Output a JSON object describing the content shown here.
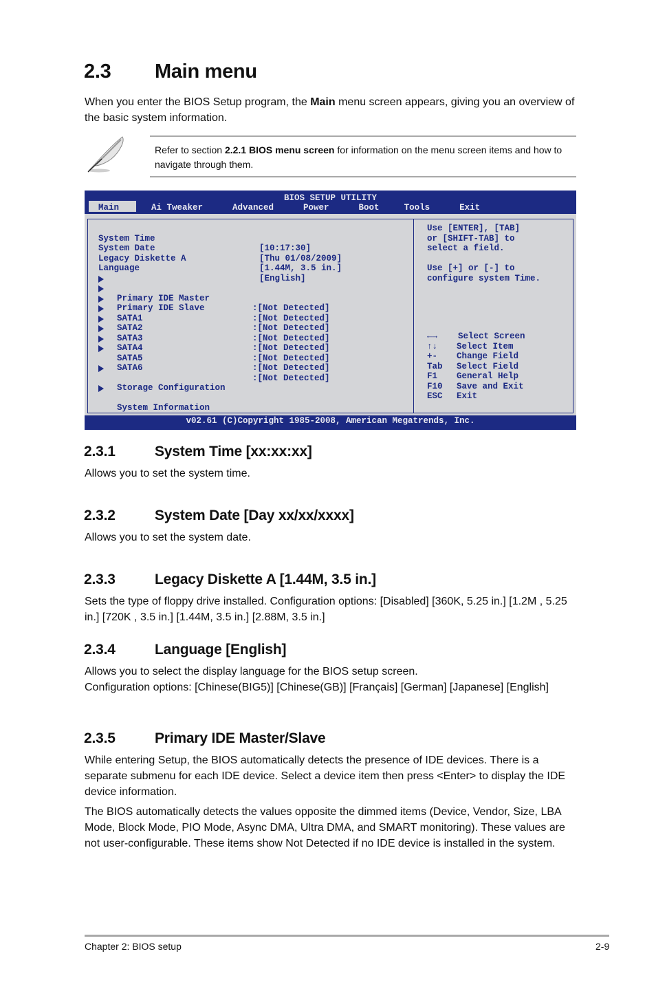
{
  "heading": {
    "number": "2.3",
    "title": "Main menu"
  },
  "intro": {
    "before": "When you enter the BIOS Setup program, the ",
    "bold": "Main",
    "after": " menu screen appears, giving you an overview of the basic system information."
  },
  "note": {
    "icon": "feather-pen-icon",
    "before": "Refer to section ",
    "bold": "2.2.1 BIOS menu screen",
    "after": " for information on the menu screen items and how to navigate through them."
  },
  "bios": {
    "title": "BIOS SETUP UTILITY",
    "tabs": [
      {
        "label": "Main",
        "active": true
      },
      {
        "label": "Ai Tweaker",
        "active": false
      },
      {
        "label": "Advanced",
        "active": false
      },
      {
        "label": "Power",
        "active": false
      },
      {
        "label": "Boot",
        "active": false
      },
      {
        "label": "Tools",
        "active": false
      },
      {
        "label": "Exit",
        "active": false
      }
    ],
    "settings": [
      {
        "label": "System Time",
        "value": "[10:17:30]"
      },
      {
        "label": "System Date",
        "value": "[Thu 01/08/2009]"
      },
      {
        "label": "Legacy Diskette A",
        "value": "[1.44M, 3.5 in.]"
      },
      {
        "label": "Language",
        "value": "[English]"
      }
    ],
    "devices": [
      {
        "label": "Primary IDE Master",
        "value": ":[Not Detected]"
      },
      {
        "label": "Primary IDE Slave",
        "value": ":[Not Detected]"
      },
      {
        "label": "SATA1",
        "value": ":[Not Detected]"
      },
      {
        "label": "SATA2",
        "value": ":[Not Detected]"
      },
      {
        "label": "SATA3",
        "value": ":[Not Detected]"
      },
      {
        "label": "SATA4",
        "value": ":[Not Detected]"
      },
      {
        "label": "SATA5",
        "value": ":[Not Detected]"
      },
      {
        "label": "SATA6",
        "value": ":[Not Detected]"
      }
    ],
    "submenus": [
      {
        "label": "Storage Configuration"
      },
      {
        "label": "System Information"
      }
    ],
    "help": [
      "Use [ENTER], [TAB]",
      "or [SHIFT-TAB] to",
      "select a field.",
      "",
      "Use [+] or [-] to",
      "configure system Time."
    ],
    "keys": [
      {
        "key": "←→",
        "action": "Select Screen"
      },
      {
        "key": "↑↓",
        "action": "Select Item"
      },
      {
        "key": "+-",
        "action": "Change Field"
      },
      {
        "key": "Tab",
        "action": "Select Field"
      },
      {
        "key": "F1",
        "action": "General Help"
      },
      {
        "key": "F10",
        "action": "Save and Exit"
      },
      {
        "key": "ESC",
        "action": "Exit"
      }
    ],
    "footer": "v02.61 (C)Copyright 1985-2008, American Megatrends, Inc.",
    "colors": {
      "frame": "#1c2a83",
      "panel": "#d4d5d8",
      "text": "#1c2a83"
    }
  },
  "sections": [
    {
      "number": "2.3.1",
      "title": "System Time [xx:xx:xx]",
      "paragraphs": [
        "Allows you to set the system time."
      ]
    },
    {
      "number": "2.3.2",
      "title": "System Date [Day xx/xx/xxxx]",
      "paragraphs": [
        "Allows you to set the system date."
      ]
    },
    {
      "number": "2.3.3",
      "title": "Legacy Diskette A [1.44M, 3.5 in.]",
      "paragraphs": [
        "Sets the type of floppy drive installed. Configuration options: [Disabled] [360K, 5.25 in.] [1.2M , 5.25 in.] [720K , 3.5 in.] [1.44M, 3.5 in.] [2.88M, 3.5 in.]"
      ]
    },
    {
      "number": "2.3.4",
      "title": "Language [English]",
      "paragraphs": [
        "Allows you to select the display language for the BIOS setup screen.",
        "Configuration options: [Chinese(BIG5)] [Chinese(GB)] [Français] [German] [Japanese] [English]"
      ]
    },
    {
      "number": "2.3.5",
      "title": "Primary IDE Master/Slave",
      "paragraphs": [
        "While entering Setup, the BIOS automatically detects the presence of IDE devices. There is a separate submenu for each IDE device. Select a device item then press <Enter> to display the IDE device information.",
        "The BIOS automatically detects the values opposite the dimmed items (Device, Vendor, Size, LBA Mode, Block Mode, PIO Mode, Async DMA, Ultra DMA, and SMART monitoring). These values are not user-configurable. These items show Not Detected if no IDE device is installed in the system."
      ]
    }
  ],
  "footer": {
    "chapter": "Chapter 2: BIOS setup",
    "page": "2-9"
  }
}
